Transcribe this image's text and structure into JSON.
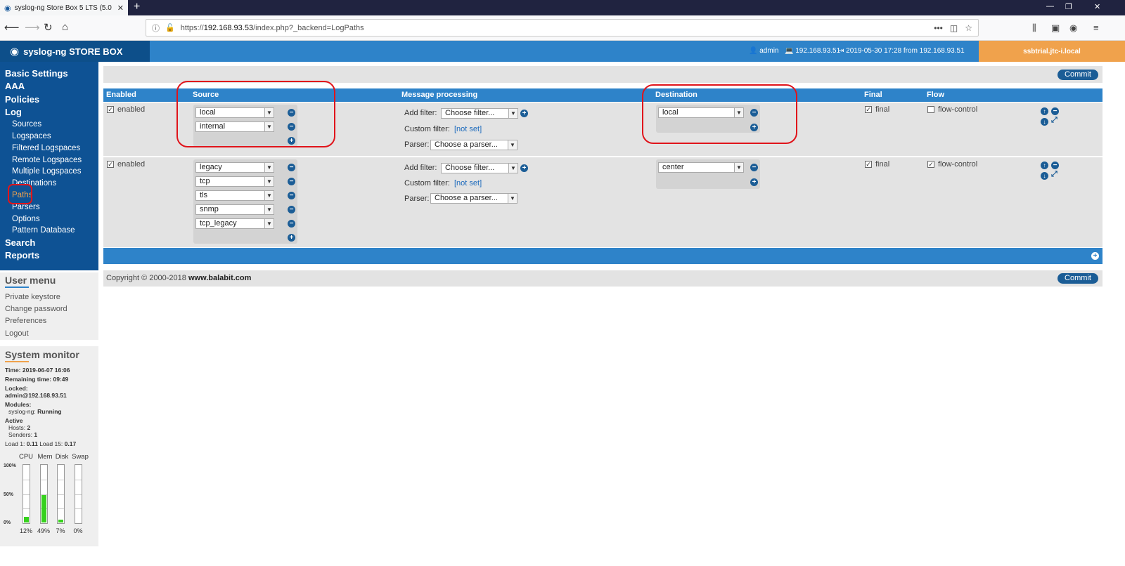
{
  "browser": {
    "tab_title": "syslog-ng Store Box 5 LTS (5.0",
    "url_prefix": "https://",
    "url_host": "192.168.93.53",
    "url_path": "/index.php?_backend=LogPaths"
  },
  "header": {
    "logo_text": "syslog-ng STORE BOX",
    "user": "admin",
    "ip": "192.168.93.51",
    "login_info": "2019-05-30 17:28 from 192.168.93.51",
    "hostname": "ssbtrial.jtc-i.local"
  },
  "nav": {
    "items": [
      {
        "label": "Basic Settings"
      },
      {
        "label": "AAA"
      },
      {
        "label": "Policies"
      },
      {
        "label": "Log"
      }
    ],
    "log_sub": [
      {
        "label": "Sources"
      },
      {
        "label": "Logspaces"
      },
      {
        "label": "Filtered Logspaces"
      },
      {
        "label": "Remote Logspaces"
      },
      {
        "label": "Multiple Logspaces"
      },
      {
        "label": "Destinations"
      },
      {
        "label": "Paths"
      },
      {
        "label": "Parsers"
      },
      {
        "label": "Options"
      },
      {
        "label": "Pattern Database"
      }
    ],
    "bottom_items": [
      {
        "label": "Search"
      },
      {
        "label": "Reports"
      }
    ]
  },
  "user_menu": {
    "title": "User menu",
    "items": [
      "Private keystore",
      "Change password",
      "Preferences",
      "Logout"
    ]
  },
  "system_monitor": {
    "title": "System monitor",
    "time_label": "Time:",
    "time": "2019-06-07 16:06",
    "remaining_label": "Remaining time:",
    "remaining": "09:49",
    "locked_label": "Locked:",
    "locked": "admin@192.168.93.51",
    "modules_label": "Modules:",
    "module_name": "syslog-ng:",
    "module_state": "Running",
    "active_label": "Active",
    "hosts_label": "Hosts:",
    "hosts": "2",
    "senders_label": "Senders:",
    "senders": "1",
    "load1_label": "Load 1:",
    "load1": "0.11",
    "load15_label": "Load 15:",
    "load15": "0.17",
    "axis": [
      "100%",
      "50%",
      "0%"
    ],
    "meters": [
      {
        "label": "CPU",
        "value": 12,
        "text": "12%"
      },
      {
        "label": "Mem",
        "value": 49,
        "text": "49%"
      },
      {
        "label": "Disk",
        "value": 7,
        "text": "7%"
      },
      {
        "label": "Swap",
        "value": 0,
        "text": "0%"
      }
    ]
  },
  "main": {
    "commit_label": "Commit",
    "columns": {
      "enabled": "Enabled",
      "source": "Source",
      "message_processing": "Message processing",
      "destination": "Destination",
      "final": "Final",
      "flow": "Flow"
    },
    "labels": {
      "enabled": "enabled",
      "add_filter": "Add filter:",
      "custom_filter": "Custom filter:",
      "not_set": "[not set]",
      "parser": "Parser:",
      "choose_filter": "Choose filter...",
      "choose_parser": "Choose a parser...",
      "final": "final",
      "flow_control": "flow-control"
    },
    "rows": [
      {
        "sources": [
          "local",
          "internal"
        ],
        "destination": "local",
        "enabled": true,
        "final": true,
        "flow_control": false
      },
      {
        "sources": [
          "legacy",
          "tcp",
          "tls",
          "snmp",
          "tcp_legacy"
        ],
        "destination": "center",
        "enabled": true,
        "final": true,
        "flow_control": true
      }
    ],
    "copyright": "Copyright © 2000-2018",
    "copyright_link": "www.balabit.com"
  }
}
